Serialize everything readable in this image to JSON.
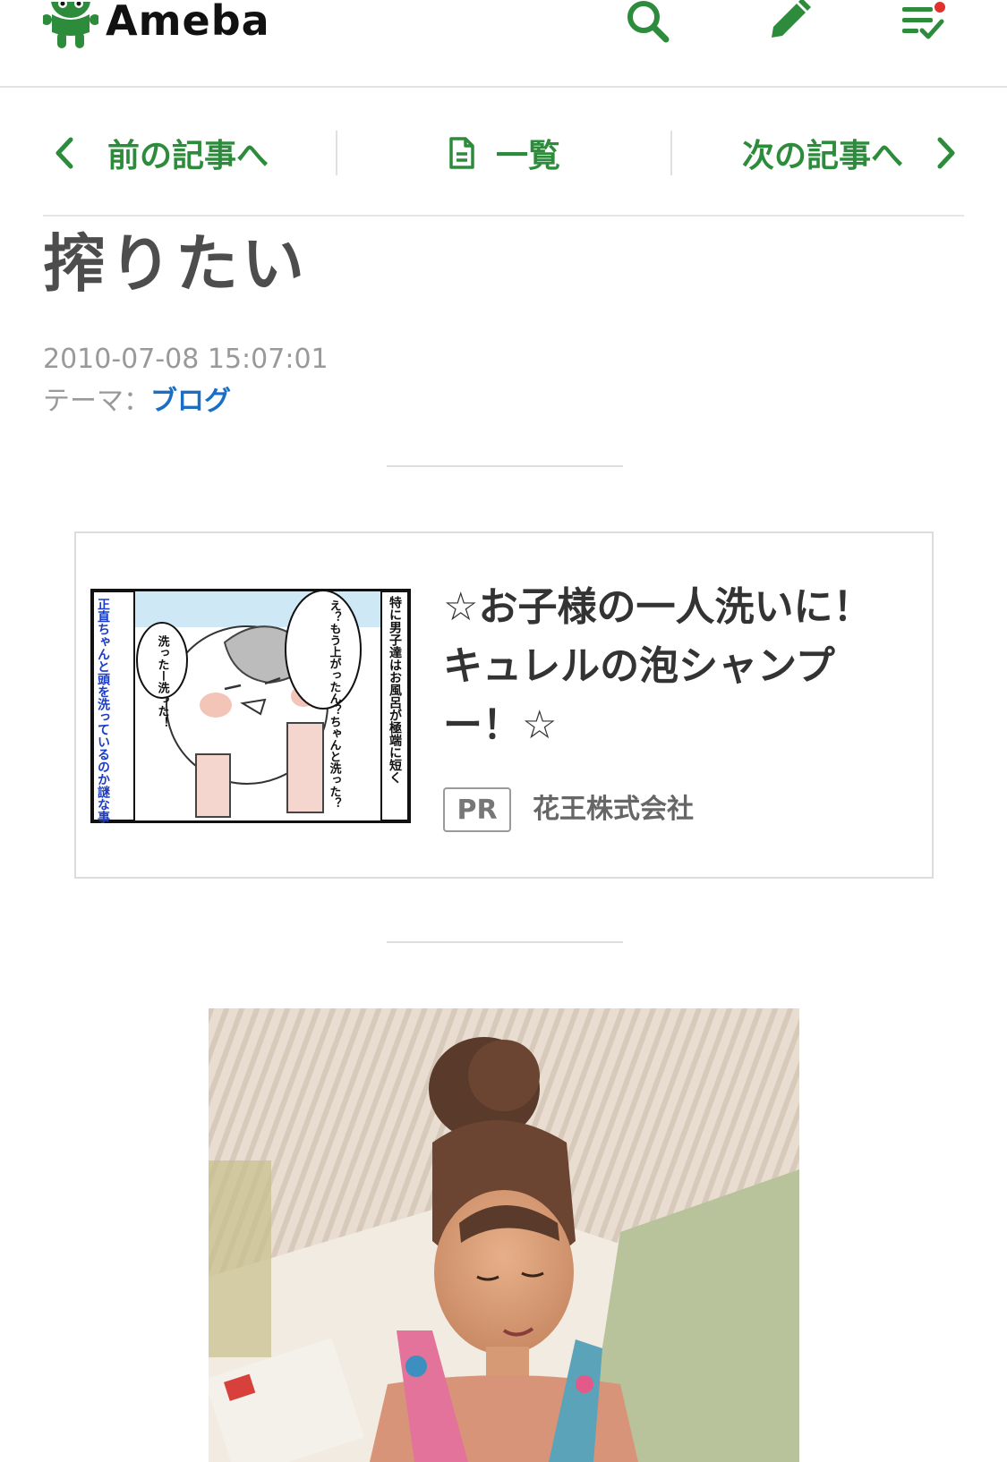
{
  "header": {
    "logo_text": "Ameba",
    "icons": [
      "search-icon",
      "pencil-icon",
      "feed-list-icon"
    ],
    "notification_dot": true
  },
  "article_nav": {
    "prev_label": "前の記事へ",
    "list_label": "一覧",
    "next_label": "次の記事へ"
  },
  "entry": {
    "title": "搾りたい",
    "date": "2010-07-08 15:07:01",
    "theme_prefix": "テーマ：",
    "theme_link": "ブログ"
  },
  "ad": {
    "title": "☆お子様の一人洗いに！キュレルの泡シャンプー！☆",
    "pr_label": "PR",
    "sponsor": "花王株式会社",
    "thumb_texts": {
      "left_caption": "正直ちゃんと頭を洗っているのか謎な事が多々あります（笑）",
      "bubble_small": "洗ったー洗った！",
      "bubble_big": "え？もう上がったん？ちゃんと洗った？",
      "right_caption": "特に男子達はお風呂が極端に短く"
    }
  },
  "colors": {
    "brand_green": "#2d8c3c",
    "link_blue": "#1a6fc4",
    "notification_red": "#e0322d"
  }
}
